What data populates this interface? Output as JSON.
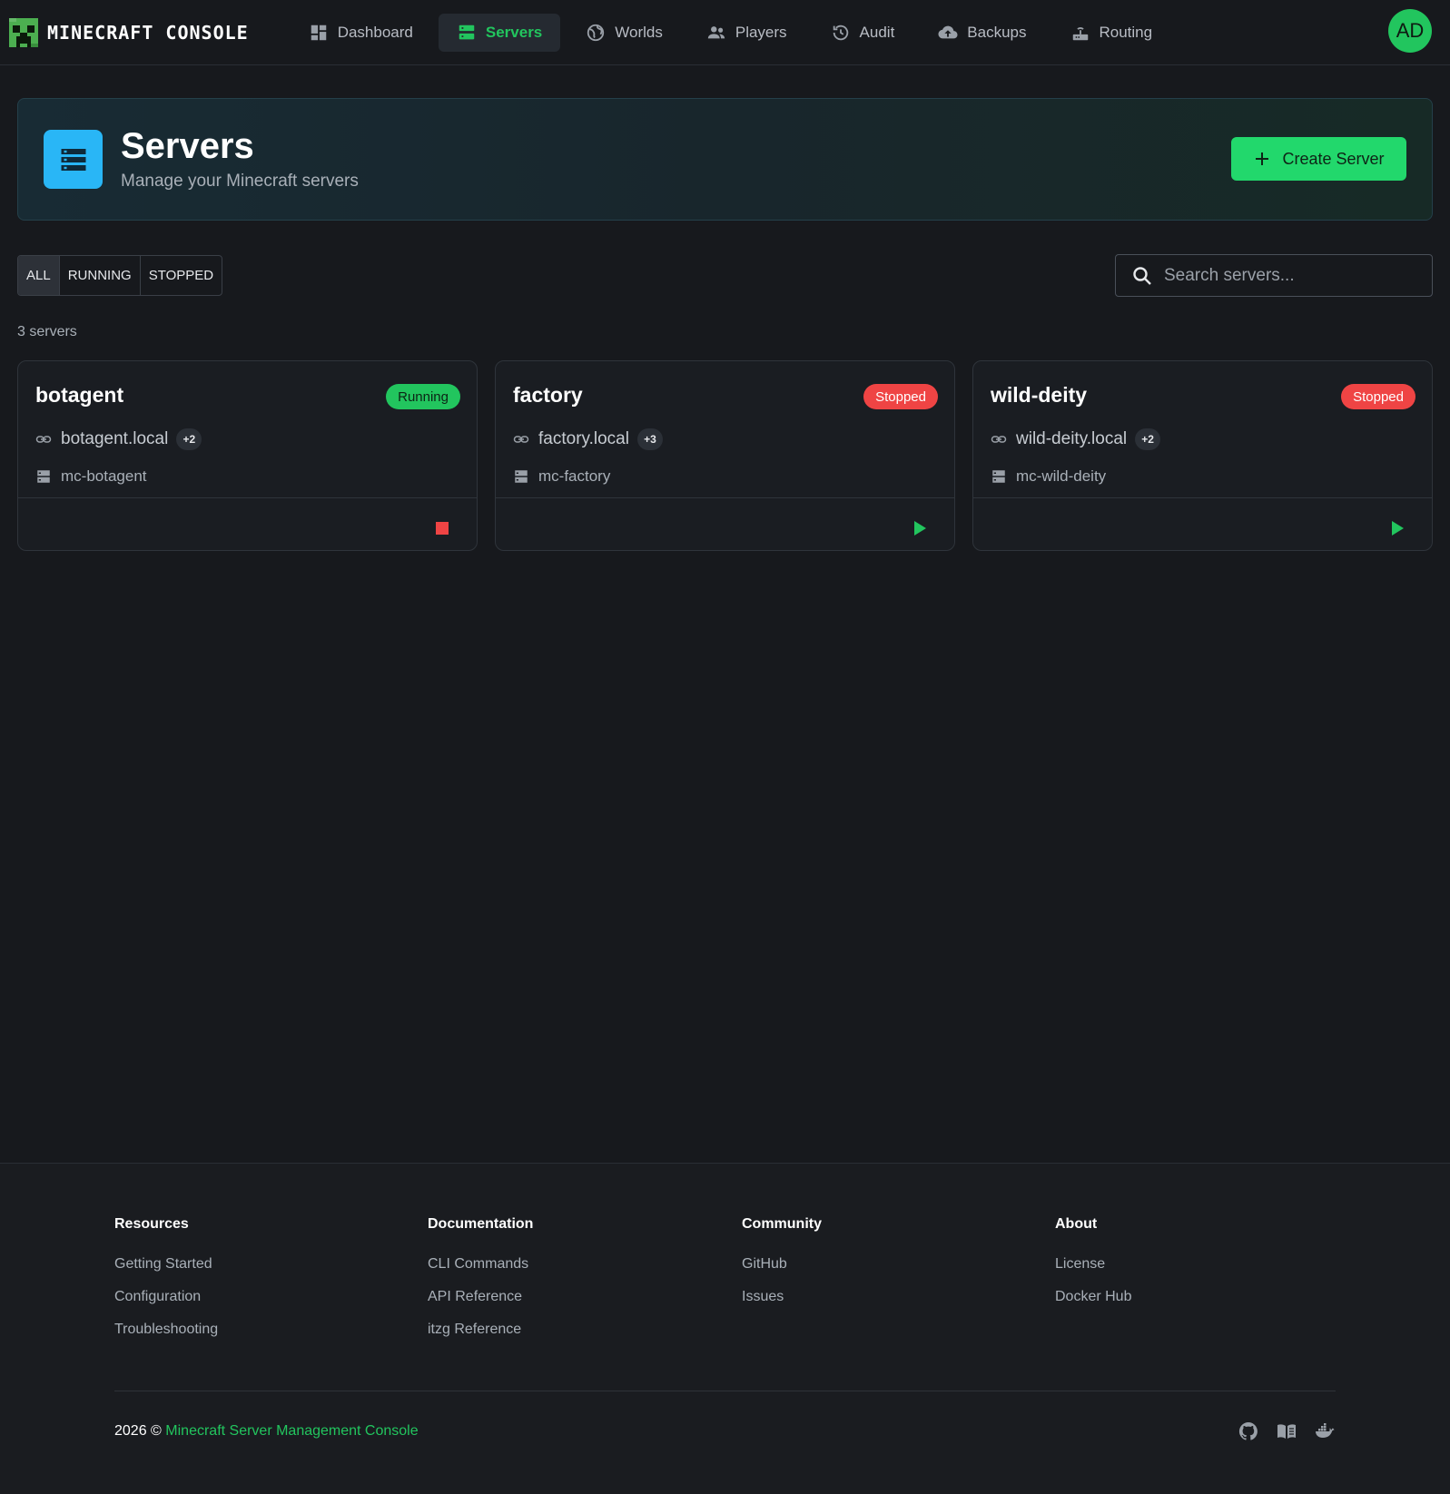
{
  "brand": {
    "name": "MINECRAFT CONSOLE"
  },
  "nav": {
    "items": [
      {
        "label": "Dashboard",
        "icon": "dashboard-icon"
      },
      {
        "label": "Servers",
        "icon": "servers-icon",
        "active": true
      },
      {
        "label": "Worlds",
        "icon": "globe-icon"
      },
      {
        "label": "Players",
        "icon": "players-icon"
      },
      {
        "label": "Audit",
        "icon": "history-icon"
      },
      {
        "label": "Backups",
        "icon": "cloud-upload-icon"
      },
      {
        "label": "Routing",
        "icon": "router-icon"
      }
    ],
    "avatar_initials": "AD"
  },
  "header": {
    "title": "Servers",
    "subtitle": "Manage your Minecraft servers",
    "create_label": "Create Server"
  },
  "filters": {
    "options": [
      "ALL",
      "RUNNING",
      "STOPPED"
    ],
    "selected": "ALL"
  },
  "search": {
    "placeholder": "Search servers..."
  },
  "server_count": "3 servers",
  "servers": [
    {
      "name": "botagent",
      "status": "Running",
      "host": "botagent.local",
      "extra_hosts": "+2",
      "container": "mc-botagent",
      "action": "stop"
    },
    {
      "name": "factory",
      "status": "Stopped",
      "host": "factory.local",
      "extra_hosts": "+3",
      "container": "mc-factory",
      "action": "start"
    },
    {
      "name": "wild-deity",
      "status": "Stopped",
      "host": "wild-deity.local",
      "extra_hosts": "+2",
      "container": "mc-wild-deity",
      "action": "start"
    }
  ],
  "colors": {
    "accent": "#22c55e",
    "running": "#22c55e",
    "stopped": "#ef4444",
    "hero_icon": "#29b6f6"
  },
  "footer": {
    "columns": [
      {
        "heading": "Resources",
        "links": [
          "Getting Started",
          "Configuration",
          "Troubleshooting"
        ]
      },
      {
        "heading": "Documentation",
        "links": [
          "CLI Commands",
          "API Reference",
          "itzg Reference"
        ]
      },
      {
        "heading": "Community",
        "links": [
          "GitHub",
          "Issues"
        ]
      },
      {
        "heading": "About",
        "links": [
          "License",
          "Docker Hub"
        ]
      }
    ],
    "copyright_prefix": "2026 ©",
    "copyright_link": "Minecraft Server Management Console",
    "icons": [
      "github-icon",
      "docs-book-icon",
      "docker-icon"
    ]
  }
}
